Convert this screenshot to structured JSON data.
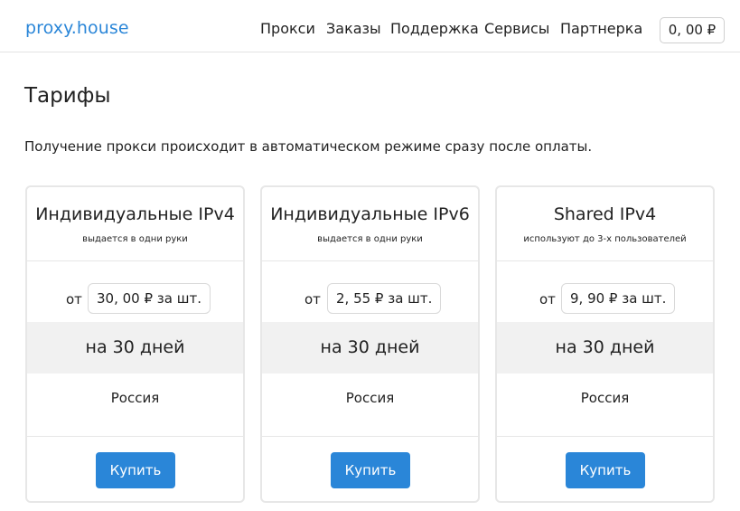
{
  "header": {
    "brand": "proxy.house",
    "nav": [
      "Прокси",
      "Заказы",
      "Поддержка",
      "Сервисы",
      "Партнерка"
    ],
    "balance": "0, 00 ₽"
  },
  "page": {
    "title": "Тарифы",
    "intro": "Получение прокси происходит в автоматическом режиме сразу после оплаты."
  },
  "cards": [
    {
      "title": "Индивидуальные IPv4",
      "subtitle": "выдается в одни руки",
      "price_prefix": "от",
      "price": "30, 00 ₽ за шт.",
      "period": "на 30 дней",
      "country": "Россия",
      "buy_label": "Купить"
    },
    {
      "title": "Индивидуальные IPv6",
      "subtitle": "выдается в одни руки",
      "price_prefix": "от",
      "price": "2, 55 ₽ за шт.",
      "period": "на 30 дней",
      "country": "Россия",
      "buy_label": "Купить"
    },
    {
      "title": "Shared IPv4",
      "subtitle": "используют до 3-х пользователей",
      "price_prefix": "от",
      "price": "9, 90 ₽ за шт.",
      "period": "на 30 дней",
      "country": "Россия",
      "buy_label": "Купить"
    }
  ],
  "colors": {
    "accent": "#2a86d8",
    "border": "#e7e7e7",
    "period_background": "#f1f1f1"
  }
}
